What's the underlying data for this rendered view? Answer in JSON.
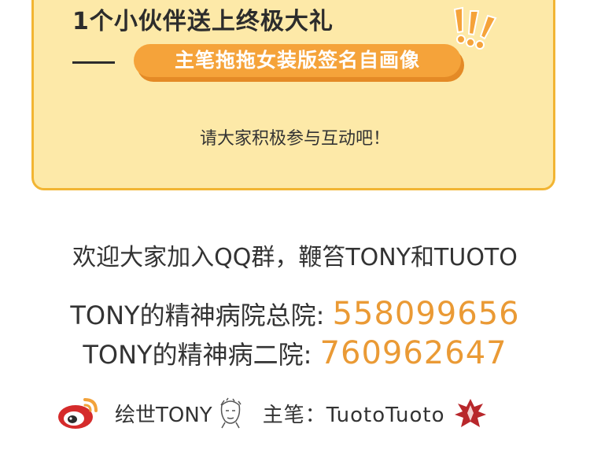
{
  "card": {
    "headline": "1个小伙伴送上终极大礼",
    "prize": "主笔拖拖女装版签名自画像",
    "invite": "请大家积极参与互动吧！"
  },
  "welcome": "欢迎大家加入QQ群，鞭笞TONY和TUOTO",
  "qq_groups": [
    {
      "label": "TONY的精神病院总院: ",
      "number": "558099656"
    },
    {
      "label": "TONY的精神病二院: ",
      "number": "760962647"
    }
  ],
  "footer": {
    "weibo_name": "绘世TONY",
    "writer_label": "主笔：TuotoTuoto"
  },
  "colors": {
    "card_bg": "#fde9a8",
    "card_border": "#f2b533",
    "accent": "#f5a33a",
    "number": "#ea9a35",
    "weibo_red": "#d52b2b"
  },
  "icons": [
    "exclamation-marks-icon",
    "weibo-icon",
    "portrait-doodle-icon",
    "red-emblem-icon"
  ]
}
